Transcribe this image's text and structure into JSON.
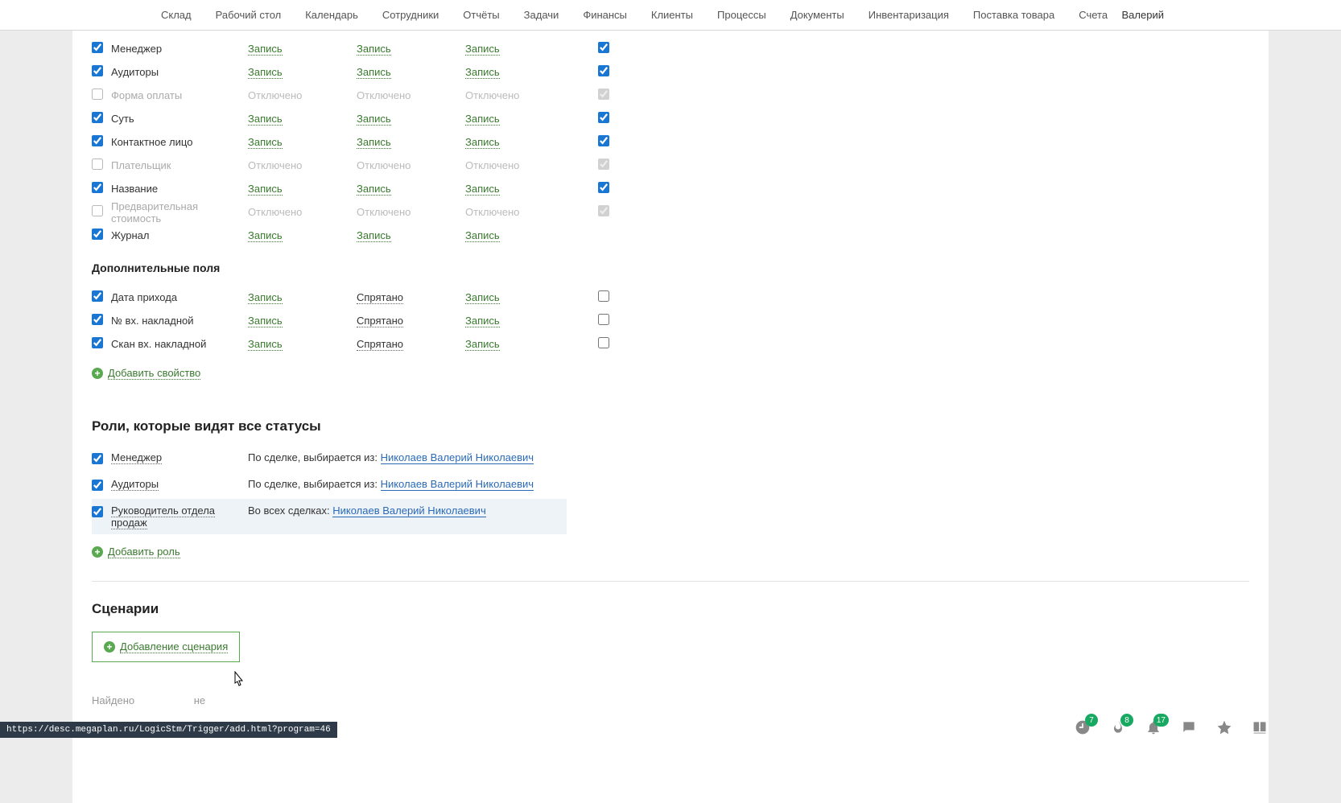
{
  "nav": {
    "items": [
      "Склад",
      "Рабочий стол",
      "Календарь",
      "Сотрудники",
      "Отчёты",
      "Задачи",
      "Финансы",
      "Клиенты",
      "Процессы",
      "Документы",
      "Инвентаризация",
      "Поставка товара",
      "Счета"
    ],
    "user": "Валерий"
  },
  "linkStates": {
    "write": "Запись",
    "hidden": "Спрятано",
    "off": "Отключено"
  },
  "mainRows": [
    {
      "chk": true,
      "label": "Менеджер",
      "c1": "write",
      "c2": "write",
      "c3": "write",
      "req": true,
      "enabled": true
    },
    {
      "chk": true,
      "label": "Аудиторы",
      "c1": "write",
      "c2": "write",
      "c3": "write",
      "req": true,
      "enabled": true
    },
    {
      "chk": false,
      "label": "Форма оплаты",
      "c1": "off",
      "c2": "off",
      "c3": "off",
      "req": true,
      "enabled": false
    },
    {
      "chk": true,
      "label": "Суть",
      "c1": "write",
      "c2": "write",
      "c3": "write",
      "req": true,
      "enabled": true
    },
    {
      "chk": true,
      "label": "Контактное лицо",
      "c1": "write",
      "c2": "write",
      "c3": "write",
      "req": true,
      "enabled": true
    },
    {
      "chk": false,
      "label": "Плательщик",
      "c1": "off",
      "c2": "off",
      "c3": "off",
      "req": true,
      "enabled": false
    },
    {
      "chk": true,
      "label": "Название",
      "c1": "write",
      "c2": "write",
      "c3": "write",
      "req": true,
      "enabled": true
    },
    {
      "chk": false,
      "label": "Предварительная стоимость",
      "c1": "off",
      "c2": "off",
      "c3": "off",
      "req": true,
      "enabled": false
    },
    {
      "chk": true,
      "label": "Журнал",
      "c1": "write",
      "c2": "write",
      "c3": "write",
      "req": null,
      "enabled": true
    }
  ],
  "additional": {
    "title": "Дополнительные поля",
    "rows": [
      {
        "chk": true,
        "label": "Дата прихода",
        "c1": "write",
        "c2": "hidden",
        "c3": "write",
        "req": false
      },
      {
        "chk": true,
        "label": "№ вх. накладной",
        "c1": "write",
        "c2": "hidden",
        "c3": "write",
        "req": false
      },
      {
        "chk": true,
        "label": "Скан вх. накладной",
        "c1": "write",
        "c2": "hidden",
        "c3": "write",
        "req": false
      }
    ],
    "add": "Добавить свойство"
  },
  "roles": {
    "title": "Роли, которые видят все статусы",
    "rows": [
      {
        "chk": true,
        "name": "Менеджер",
        "prefix": "По сделке, выбирается из: ",
        "person": "Николаев Валерий Николаевич"
      },
      {
        "chk": true,
        "name": "Аудиторы",
        "prefix": "По сделке, выбирается из: ",
        "person": "Николаев Валерий Николаевич"
      },
      {
        "chk": true,
        "name": "Руководитель отдела продаж",
        "prefix": "Во всех сделках: ",
        "person": "Николаев Валерий Николаевич"
      }
    ],
    "add": "Добавить роль"
  },
  "scenarios": {
    "title": "Сценарии",
    "add": "Добавление сценария"
  },
  "footer": {
    "text": "Найдено",
    "text2": "не"
  },
  "status": "https://desc.megaplan.ru/LogicStm/Trigger/add.html?program=46",
  "badges": {
    "clock": "7",
    "fire": "8",
    "bell": "17"
  }
}
